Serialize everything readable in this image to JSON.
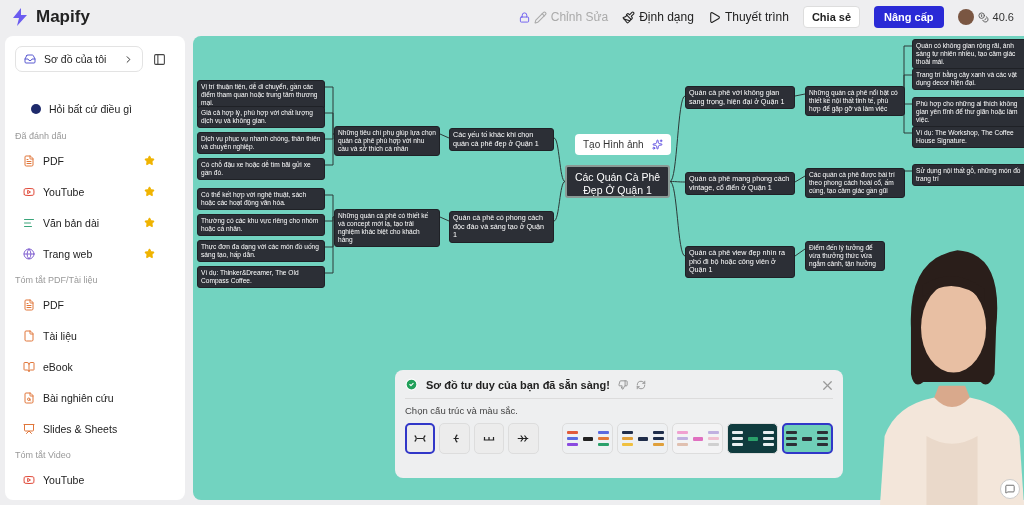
{
  "topbar": {
    "app_name": "Mapify",
    "actions": [
      {
        "kind": "edit",
        "label": "Chỉnh Sửa",
        "disabled": true
      },
      {
        "kind": "format",
        "label": "Định dạng",
        "disabled": false
      },
      {
        "kind": "present",
        "label": "Thuyết trình",
        "disabled": false
      }
    ],
    "share": "Chia sẻ",
    "upgrade": "Nâng cấp",
    "credits": "40.6"
  },
  "sidebar": {
    "my_maps": "Sơ đồ của tôi",
    "ask": "Hỏi bất cứ điều gì",
    "sections": [
      {
        "title": "Đã đánh dấu",
        "items": [
          {
            "kind": "pdf",
            "label": "PDF",
            "starred": true
          },
          {
            "kind": "youtube",
            "label": "YouTube",
            "starred": true
          },
          {
            "kind": "text",
            "label": "Văn bản dài",
            "starred": true
          },
          {
            "kind": "web",
            "label": "Trang web",
            "starred": true
          }
        ]
      },
      {
        "title": "Tóm tắt PDF/Tài liệu",
        "items": [
          {
            "kind": "pdf",
            "label": "PDF",
            "starred": false
          },
          {
            "kind": "doc",
            "label": "Tài liệu",
            "starred": false
          },
          {
            "kind": "ebook",
            "label": "eBook",
            "starred": false
          },
          {
            "kind": "paper",
            "label": "Bài nghiên cứu",
            "starred": false
          },
          {
            "kind": "slides",
            "label": "Slides & Sheets",
            "starred": false
          }
        ]
      },
      {
        "title": "Tóm tắt Video",
        "items": [
          {
            "kind": "youtube",
            "label": "YouTube",
            "starred": false
          }
        ]
      }
    ]
  },
  "mindmap": {
    "center": "Các Quán Cà Phê Đẹp Ở Quận 1",
    "tooltip": "Tạo Hình ảnh",
    "branches": [
      {
        "label": "Các yếu tố khác khi chọn quán cà phê đẹp ở Quận 1",
        "sub": "Những tiêu chí phụ giúp lựa chọn quán cà phê phù hợp với nhu cầu và sở thích cá nhân",
        "leaves": [
          "Vị trí thuận tiện, dễ di chuyển, gần các điểm tham quan hoặc trung tâm thương mại.",
          "Giá cả hợp lý, phù hợp với chất lượng dịch vụ và không gian.",
          "Dịch vụ phục vụ nhanh chóng, thân thiện và chuyên nghiệp.",
          "Có chỗ đậu xe hoặc dễ tìm bãi gửi xe gần đó."
        ]
      },
      {
        "label": "Quán cà phê có phong cách độc đáo và sáng tạo ở Quận 1",
        "sub": "Những quán cà phê có thiết kế và concept mới lạ, tạo trải nghiệm khác biệt cho khách hàng",
        "leaves": [
          "Có thể kết hợp với nghệ thuật, sách hoặc các hoạt động văn hóa.",
          "Thường có các khu vực riêng cho nhóm hoặc cá nhân.",
          "Thực đơn đa dạng với các món đồ uống sáng tạo, hấp dẫn.",
          "Ví dụ: Thinker&Dreamer, The Old Compass Coffee."
        ]
      },
      {
        "label": "Quán cà phê với không gian sang trọng, hiện đại ở Quận 1",
        "sub": "Những quán cà phê nổi bật có thiết kế nội thất tinh tế, phù hợp để gặp gỡ và làm việc",
        "leaves": [
          "Quán có không gian rộng rãi, ánh sáng tự nhiên nhiều, tạo cảm giác thoải mái.",
          "Trang trí bằng cây xanh và các vật dụng decor hiện đại.",
          "Phù hợp cho những ai thích không gian yên tĩnh để thư giãn hoặc làm việc.",
          "Ví dụ: The Workshop, The Coffee House Signature."
        ]
      },
      {
        "label": "Quán cà phê mang phong cách vintage, cổ điển ở Quận 1",
        "sub": "Các quán cà phê được bài trí theo phong cách hoài cổ, ấm cúng, tạo cảm giác gần gũi",
        "leaves": [
          "Sử dụng nội thất gỗ, những món đồ trang trí"
        ]
      },
      {
        "label": "Quán cà phê view đẹp nhìn ra phố đi bộ hoặc công viên ở Quận 1",
        "sub": "Điểm đến lý tưởng để vừa thưởng thức vừa ngắm cảnh, tận hưởng"
      }
    ]
  },
  "ready_panel": {
    "title": "Sơ đồ tư duy của bạn đã sẵn sàng!",
    "prompt": "Chọn cấu trúc và màu sắc.",
    "structures": [
      {
        "kind": "mindmap",
        "selected": true
      },
      {
        "kind": "right",
        "selected": false
      },
      {
        "kind": "org",
        "selected": false
      },
      {
        "kind": "fishbone",
        "selected": false
      }
    ],
    "themes": [
      {
        "kind": "rainbow",
        "selected": false
      },
      {
        "kind": "navy",
        "selected": false
      },
      {
        "kind": "pastel",
        "selected": false
      },
      {
        "kind": "dark",
        "selected": false
      },
      {
        "kind": "teal",
        "selected": true
      }
    ]
  }
}
